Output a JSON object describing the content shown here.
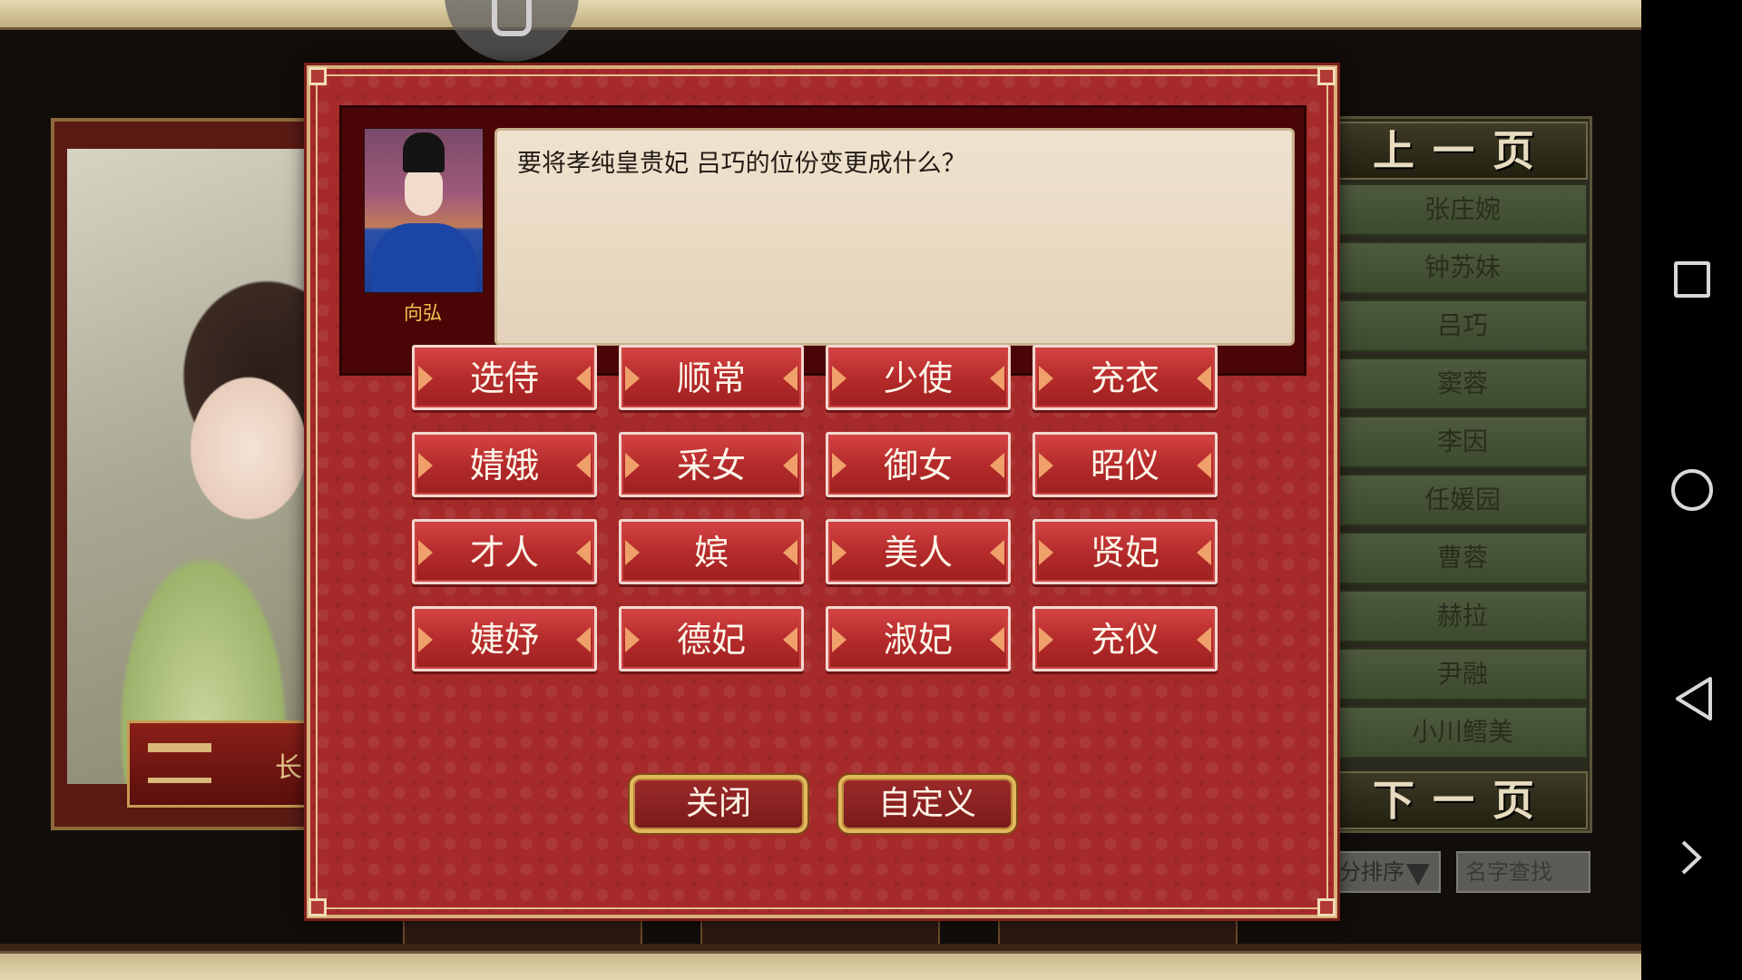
{
  "dialog": {
    "speaker_name": "向弘",
    "message": "要将孝纯皇贵妃 吕巧的位份变更成什么？",
    "ranks": [
      "选侍",
      "顺常",
      "少使",
      "充衣",
      "婧娥",
      "采女",
      "御女",
      "昭仪",
      "才人",
      "嫔",
      "美人",
      "贤妃",
      "婕妤",
      "德妃",
      "淑妃",
      "充仪"
    ],
    "close_label": "关闭",
    "custom_label": "自定义"
  },
  "list": {
    "prev_page_label": "上一页",
    "next_page_label": "下一页",
    "items": [
      "张庄婉",
      "钟苏妹",
      "吕巧",
      "窦蓉",
      "李因",
      "任媛园",
      "曹蓉",
      "赫拉",
      "尹融",
      "小川鳕美"
    ],
    "sort_label": "分排序",
    "search_placeholder": "名字查找"
  },
  "portrait": {
    "nameplate_text": "长"
  },
  "colors": {
    "dialog_bg": "#a62a2a",
    "button_red": "#b52b2b",
    "gold_border": "#e4b85e",
    "speaker_name": "#f2c24e"
  },
  "nav": {
    "icons": [
      "recent-apps-icon",
      "home-icon",
      "back-icon",
      "chevron-right-icon"
    ]
  }
}
